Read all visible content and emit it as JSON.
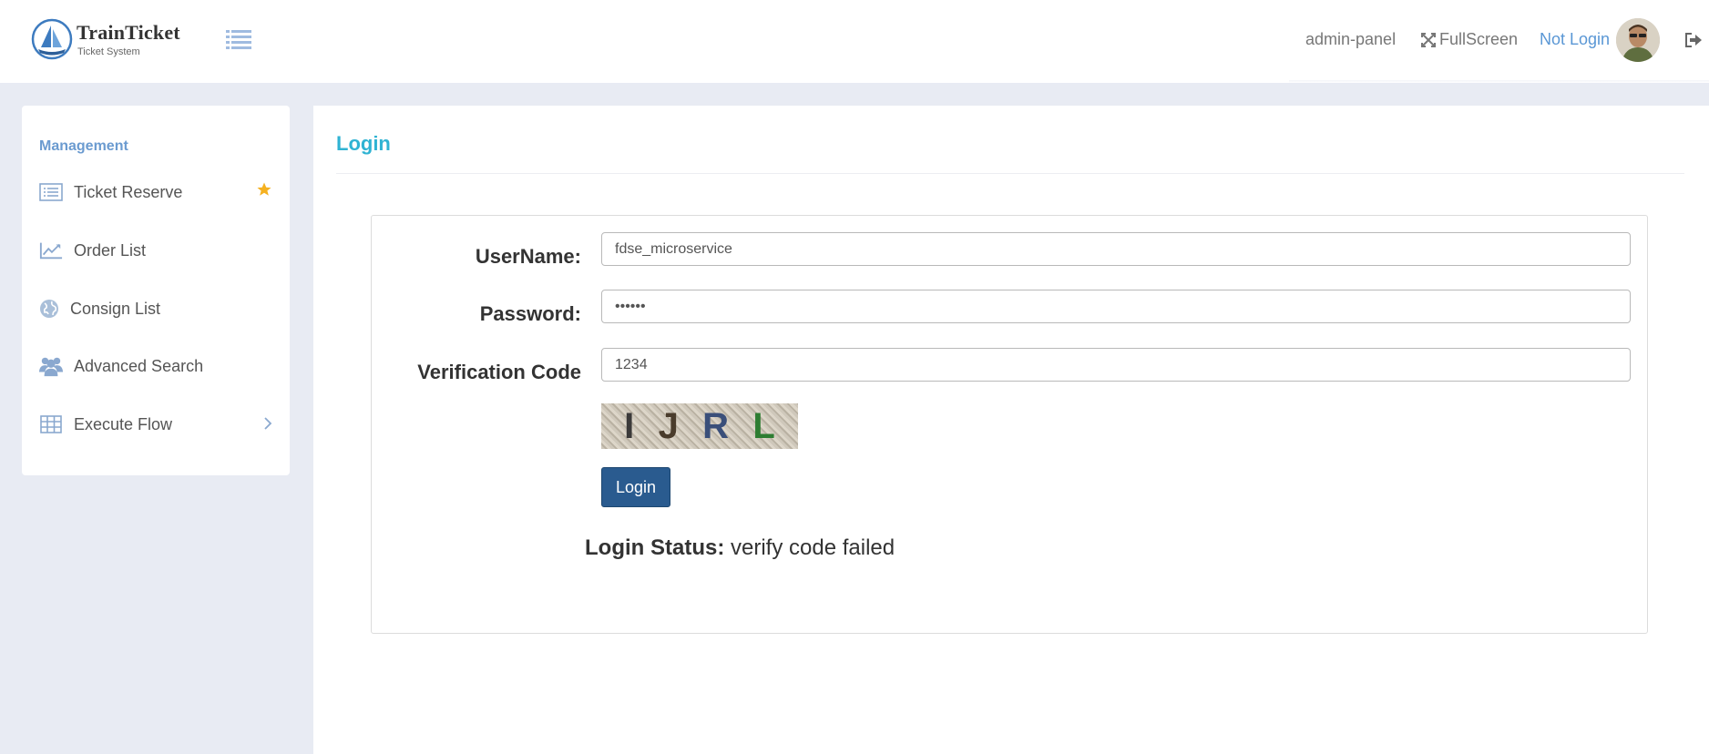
{
  "header": {
    "logo_title": "TrainTicket",
    "logo_subtitle": "Ticket System",
    "admin_link": "admin-panel",
    "fullscreen_label": "FullScreen",
    "login_state": "Not Login"
  },
  "sidebar": {
    "section_title": "Management",
    "items": [
      {
        "label": "Ticket Reserve",
        "icon": "list-icon"
      },
      {
        "label": "Order List",
        "icon": "chart-line-icon"
      },
      {
        "label": "Consign List",
        "icon": "globe-icon"
      },
      {
        "label": "Advanced Search",
        "icon": "users-icon"
      },
      {
        "label": "Execute Flow",
        "icon": "table-icon"
      }
    ]
  },
  "main": {
    "title": "Login",
    "form": {
      "username_label": "UserName:",
      "username_value": "fdse_microservice",
      "password_label": "Password:",
      "password_value": "111111",
      "verification_label": "Verification Code",
      "verification_value": "1234",
      "captcha_chars": [
        "I",
        "J",
        "R",
        "L"
      ],
      "login_button": "Login"
    },
    "status_label": "Login Status:",
    "status_text": "verify code failed"
  },
  "colors": {
    "accent": "#2fb3d3",
    "sidebar_title": "#6b9bd0",
    "link": "#5a97d5",
    "button": "#2a5b8f",
    "star": "#f5b120"
  }
}
